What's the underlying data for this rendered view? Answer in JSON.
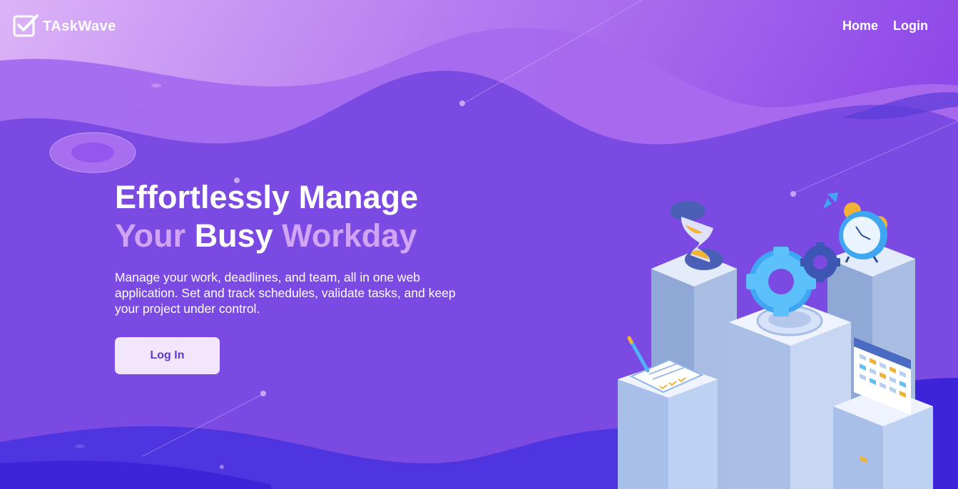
{
  "brand": {
    "name": "TAskWave",
    "icon": "checkbox-icon"
  },
  "nav": {
    "home": "Home",
    "login": "Login"
  },
  "hero": {
    "line1": "Effortlessly Manage",
    "line2_a": "Your",
    "line2_b": "Busy",
    "line2_c": "Workday",
    "description": "Manage your work, deadlines, and team, all in one web application. Set and track schedules, validate tasks, and keep your project under control.",
    "cta": "Log In"
  },
  "colors": {
    "background": "#7a4ae3",
    "accent_text": "#d2a4f6",
    "button_bg": "#f1e6fc",
    "button_text": "#5b3ad0"
  }
}
